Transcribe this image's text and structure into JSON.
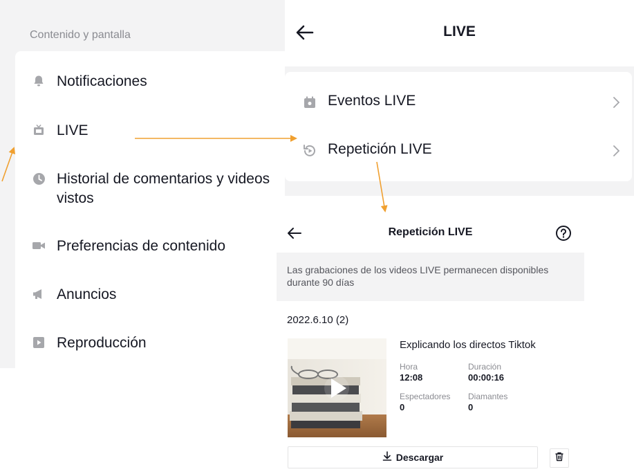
{
  "content_settings": {
    "header": "Contenido y pantalla",
    "items": [
      {
        "label": "Notificaciones",
        "icon": "bell-icon"
      },
      {
        "label": "LIVE",
        "icon": "live-tv-icon"
      },
      {
        "label": "Historial de comentarios y videos vistos",
        "icon": "clock-icon"
      },
      {
        "label": "Preferencias de contenido",
        "icon": "video-camera-icon"
      },
      {
        "label": "Anuncios",
        "icon": "megaphone-icon"
      },
      {
        "label": "Reproducción",
        "icon": "play-square-icon"
      }
    ]
  },
  "live_settings": {
    "title": "LIVE",
    "rows": [
      {
        "label": "Eventos LIVE",
        "icon": "calendar-event-icon"
      },
      {
        "label": "Repetición LIVE",
        "icon": "replay-icon"
      }
    ]
  },
  "live_replay": {
    "title": "Repetición LIVE",
    "note": "Las grabaciones de los videos LIVE permanecen disponibles durante 90 días",
    "date_group": "2022.6.10 (2)",
    "video": {
      "title": "Explicando los directos Tiktok",
      "hora_label": "Hora",
      "hora_value": "12:08",
      "duracion_label": "Duración",
      "duracion_value": "00:00:16",
      "espectadores_label": "Espectadores",
      "espectadores_value": "0",
      "diamantes_label": "Diamantes",
      "diamantes_value": "0"
    },
    "download_label": "Descargar"
  },
  "colors": {
    "arrow": "#f0a030",
    "text": "#161823",
    "muted": "#8a8b91",
    "icon": "#a6a7ab",
    "bg": "#f3f3f4"
  }
}
